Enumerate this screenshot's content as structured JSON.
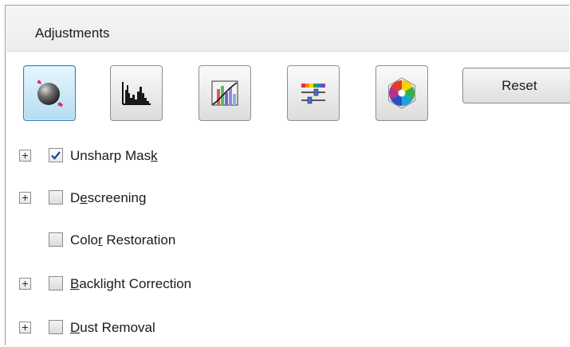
{
  "panel": {
    "title": "Adjustments"
  },
  "toolbar": {
    "buttons": [
      {
        "name": "auto-exposure",
        "icon": "auto-exposure-icon",
        "active": true
      },
      {
        "name": "histogram",
        "icon": "histogram-icon",
        "active": false
      },
      {
        "name": "tone-correction",
        "icon": "tone-curve-icon",
        "active": false
      },
      {
        "name": "image-adjustment",
        "icon": "sliders-icon",
        "active": false
      },
      {
        "name": "color-palette",
        "icon": "color-wheel-icon",
        "active": false
      }
    ],
    "reset_label": "Reset"
  },
  "options": [
    {
      "label_before": "Unsharp Mas",
      "label_accel": "k",
      "label_after": "",
      "checked": true,
      "expandable": true
    },
    {
      "label_before": "D",
      "label_accel": "e",
      "label_after": "screening",
      "checked": false,
      "expandable": true
    },
    {
      "label_before": "Colo",
      "label_accel": "r",
      "label_after": " Restoration",
      "checked": false,
      "expandable": false
    },
    {
      "label_before": "",
      "label_accel": "B",
      "label_after": "acklight Correction",
      "checked": false,
      "expandable": true
    },
    {
      "label_before": "",
      "label_accel": "D",
      "label_after": "ust Removal",
      "checked": false,
      "expandable": true
    }
  ],
  "colors": {
    "active_button_bg": "#b4dcf3",
    "check_mark": "#1f3f9a"
  }
}
